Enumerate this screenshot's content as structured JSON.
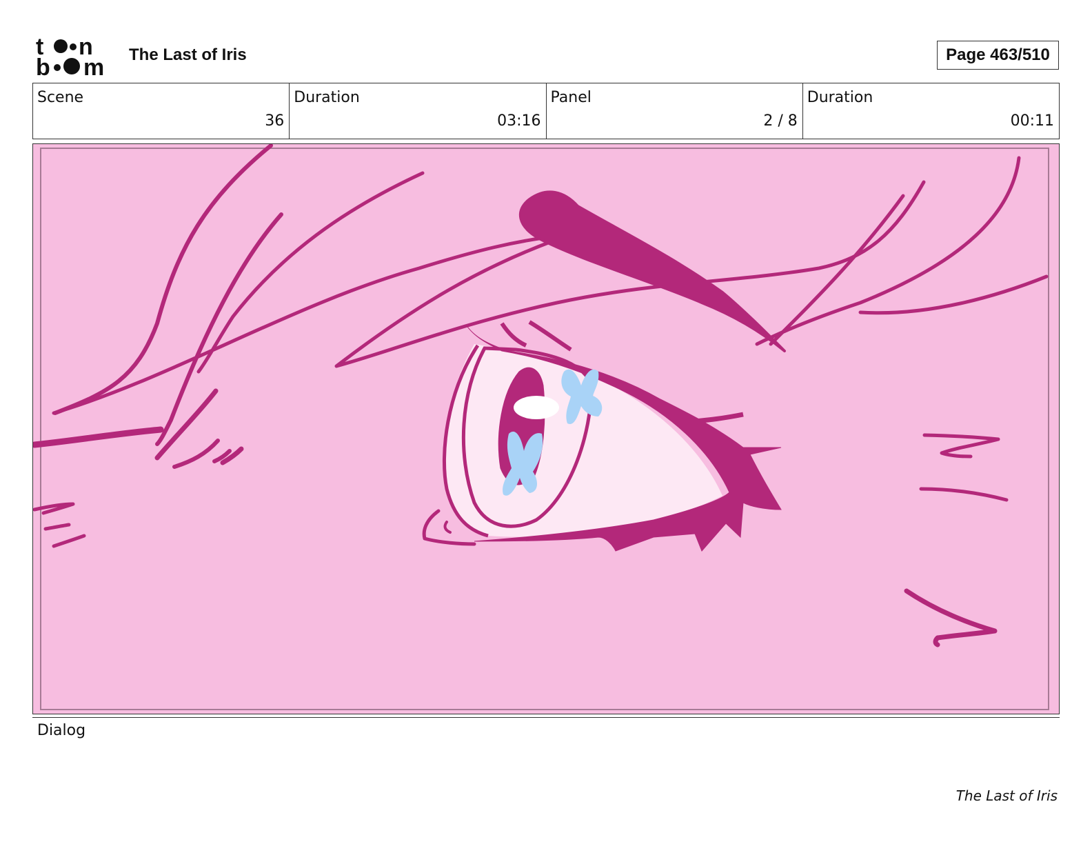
{
  "header": {
    "logo_text": "toon boom",
    "title": "The Last of Iris",
    "page": "Page 463/510"
  },
  "info": {
    "scene_label": "Scene",
    "scene_value": "36",
    "scene_duration_label": "Duration",
    "scene_duration_value": "03:16",
    "panel_label": "Panel",
    "panel_value": "2 / 8",
    "panel_duration_label": "Duration",
    "panel_duration_value": "00:11"
  },
  "panel": {
    "background_color": "#f7bde0",
    "line_color": "#b3287a",
    "eye_white_color": "#fde8f4",
    "accent_color": "#a9d3f7"
  },
  "dialog": {
    "label": "Dialog"
  },
  "footer": {
    "title": "The Last of Iris"
  }
}
